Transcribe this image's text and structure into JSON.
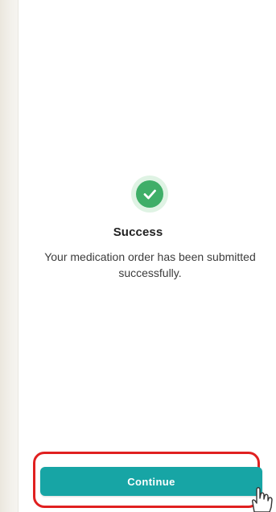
{
  "screen": {
    "status": "success",
    "title": "Success",
    "message": "Your medication order has been submitted successfully."
  },
  "actions": {
    "continue_label": "Continue"
  },
  "icons": {
    "status_icon": "check-circle-icon",
    "cursor_icon": "hand-pointer-icon"
  },
  "colors": {
    "accent": "#17a5a5",
    "success": "#3fae68",
    "success_bg": "#dff3e4",
    "highlight": "#e02020"
  }
}
